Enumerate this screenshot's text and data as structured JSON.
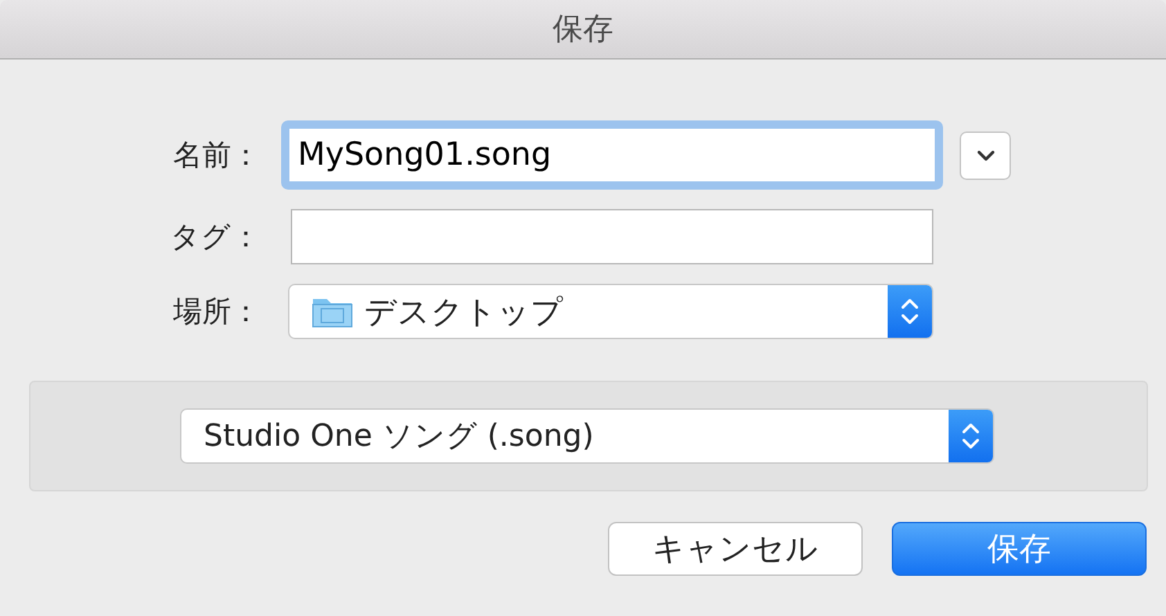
{
  "window": {
    "title": "保存"
  },
  "fields": [
    {
      "kind": "text",
      "label": "名前：",
      "value": "MySong01.song",
      "focused": true
    },
    {
      "kind": "text",
      "label": "タグ：",
      "focused": false
    },
    {
      "kind": "popup",
      "label": "場所：",
      "value": "デスクトップ"
    }
  ],
  "format": {
    "value": "Studio One ソング (.song)"
  },
  "buttons": [
    {
      "label": "キャンセル",
      "kind": "normal"
    },
    {
      "label": "保存",
      "kind": "default"
    }
  ]
}
